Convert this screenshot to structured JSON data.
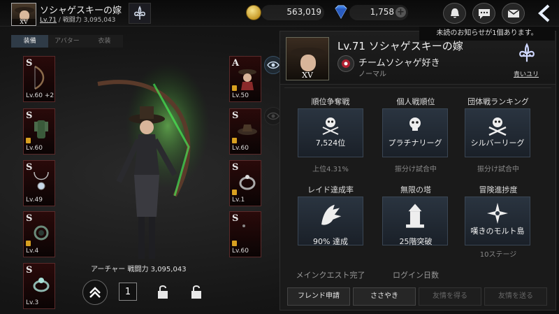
{
  "header": {
    "player_name": "ソシャゲスキーの嫁",
    "level_prefix": "Lv.71",
    "power_text": "/ 戦闘力 3,095,043",
    "avatar_rank": "XV",
    "gold": "563,019",
    "gems": "1,758"
  },
  "notice": "未読のお知らせが1個あります。",
  "tabs": [
    "装備",
    "アバター",
    "衣装"
  ],
  "left_slots": [
    {
      "grade": "S",
      "level": "Lv.60",
      "extra": "+2"
    },
    {
      "grade": "S",
      "level": "Lv.60",
      "extra": ""
    },
    {
      "grade": "S",
      "level": "Lv.49",
      "extra": ""
    },
    {
      "grade": "S",
      "level": "Lv.4",
      "extra": ""
    },
    {
      "grade": "S",
      "level": "Lv.3",
      "extra": ""
    }
  ],
  "right_slots": [
    {
      "grade": "A",
      "level": "Lv.50"
    },
    {
      "grade": "S",
      "level": "Lv.60"
    },
    {
      "grade": "S",
      "level": "Lv.1"
    },
    {
      "grade": "S",
      "level": "Lv.60"
    }
  ],
  "character_label": "アーチャー 戦闘力 3,095,043",
  "bottom_count": "1",
  "profile": {
    "name": "Lv.71 ソシャゲスキーの嫁",
    "rank": "XV",
    "guild": "チームソシャゲ好き",
    "tier": "ノーマル",
    "emblem_label": "青いユリ"
  },
  "stats": [
    {
      "title": "順位争奪戦",
      "value": "7,524位",
      "sub": "上位4.31%",
      "icon": "skull-swords-icon"
    },
    {
      "title": "個人戦順位",
      "value": "プラチナリーグ",
      "sub": "振分け試合中",
      "icon": "skull-icon"
    },
    {
      "title": "団体戦ランキング",
      "value": "シルバーリーグ",
      "sub": "振分け試合中",
      "icon": "skull-crossbones-icon"
    },
    {
      "title": "レイド達成率",
      "value": "",
      "sub": "90% 達成",
      "icon": "dragon-icon"
    },
    {
      "title": "無限の塔",
      "value": "",
      "sub": "25階突破",
      "icon": "tower-icon"
    },
    {
      "title": "冒険進捗度",
      "value": "嘆きのモルト島",
      "sub": "10ステージ",
      "icon": "compass-icon"
    }
  ],
  "more_titles": [
    "メインクエスト完了",
    "ログイン日数"
  ],
  "buttons": [
    "フレンド申請",
    "ささやき",
    "友情を得る",
    "友情を送る"
  ],
  "colors": {
    "accent": "#2f3b47",
    "slot_bg": "#2a0a0a",
    "lock": "#d8a020",
    "card": "#2a3440"
  }
}
